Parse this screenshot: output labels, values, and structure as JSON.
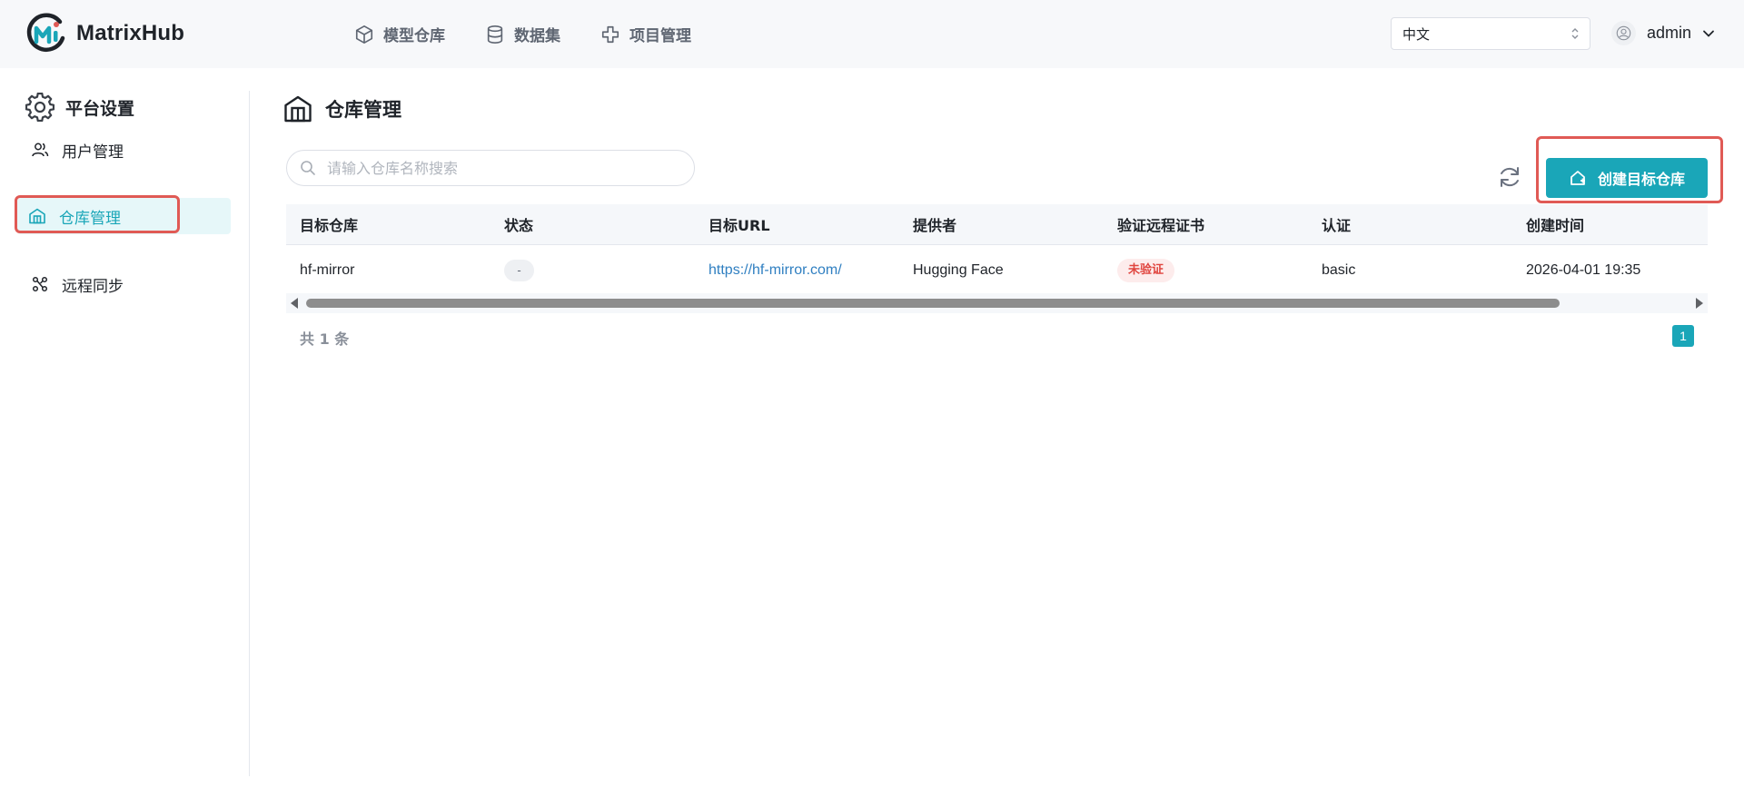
{
  "app": {
    "name": "MatrixHub"
  },
  "top_nav": [
    {
      "label": "模型仓库",
      "icon": "cube-icon"
    },
    {
      "label": "数据集",
      "icon": "database-icon"
    },
    {
      "label": "项目管理",
      "icon": "cross-plus-icon"
    }
  ],
  "language": {
    "selected": "中文"
  },
  "user": {
    "name": "admin"
  },
  "sidebar": {
    "title": "平台设置",
    "items": [
      {
        "label": "用户管理",
        "icon": "users-icon",
        "active": false
      },
      {
        "label": "仓库管理",
        "icon": "warehouse-icon",
        "active": true
      },
      {
        "label": "远程同步",
        "icon": "sync-nodes-icon",
        "active": false
      }
    ]
  },
  "main": {
    "title": "仓库管理",
    "search": {
      "placeholder": "请输入仓库名称搜索",
      "value": ""
    },
    "create_button_label": "创建目标仓库",
    "table": {
      "columns": [
        "目标仓库",
        "状态",
        "目标URL",
        "提供者",
        "验证远程证书",
        "认证",
        "创建时间"
      ],
      "rows": [
        {
          "name": "hf-mirror",
          "status": "-",
          "url": "https://hf-mirror.com/",
          "provider": "Hugging Face",
          "cert_verify": "未验证",
          "auth": "basic",
          "created_at": "2026-04-01 19:35"
        }
      ]
    },
    "pagination": {
      "total_text": "共 1 条",
      "current_page": "1"
    },
    "scrollbar_position": 0
  },
  "colors": {
    "accent": "#1aa6b8",
    "highlight_border": "#e05a55",
    "warning_text": "#e0443e",
    "link": "#2f7fc1"
  }
}
